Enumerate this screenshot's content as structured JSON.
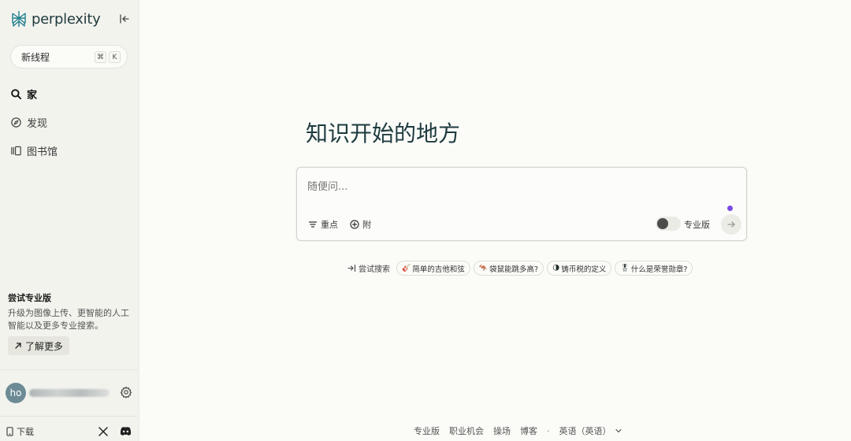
{
  "brand": {
    "name": "perplexity"
  },
  "sidebar": {
    "new_thread": {
      "label": "新线程",
      "shortcut": [
        "⌘",
        "K"
      ]
    },
    "nav": [
      {
        "label": "家",
        "icon": "search-icon",
        "active": true
      },
      {
        "label": "发现",
        "icon": "compass-icon",
        "active": false
      },
      {
        "label": "图书馆",
        "icon": "library-icon",
        "active": false
      }
    ],
    "promo": {
      "title": "尝试专业版",
      "description": "升级为图像上传、更智能的人工智能以及更多专业搜索。",
      "button": "了解更多"
    },
    "user": {
      "initials": "ho"
    },
    "download_label": "下载"
  },
  "main": {
    "title": "知识开始的地方",
    "search": {
      "placeholder": "随便问...",
      "focus_label": "重点",
      "attach_label": "附",
      "pro_label": "专业版"
    },
    "suggestions": {
      "try_label": "尝试搜索",
      "items": [
        {
          "emoji": "🎸",
          "label": "简单的吉他和弦"
        },
        {
          "emoji": "🦘",
          "label": "袋鼠能跳多高?"
        },
        {
          "emoji": "🌗",
          "label": "铸币税的定义"
        },
        {
          "emoji": "🎖",
          "label": "什么是荣誉勋章?"
        }
      ]
    },
    "footer": {
      "links": [
        "专业版",
        "职业机会",
        "操场",
        "博客"
      ],
      "separator": "·",
      "language": "英语（英语）"
    }
  },
  "colors": {
    "accent_dot": "#7b4be6",
    "brand_teal": "#1e3b3f",
    "avatar": "#6c8b95"
  }
}
